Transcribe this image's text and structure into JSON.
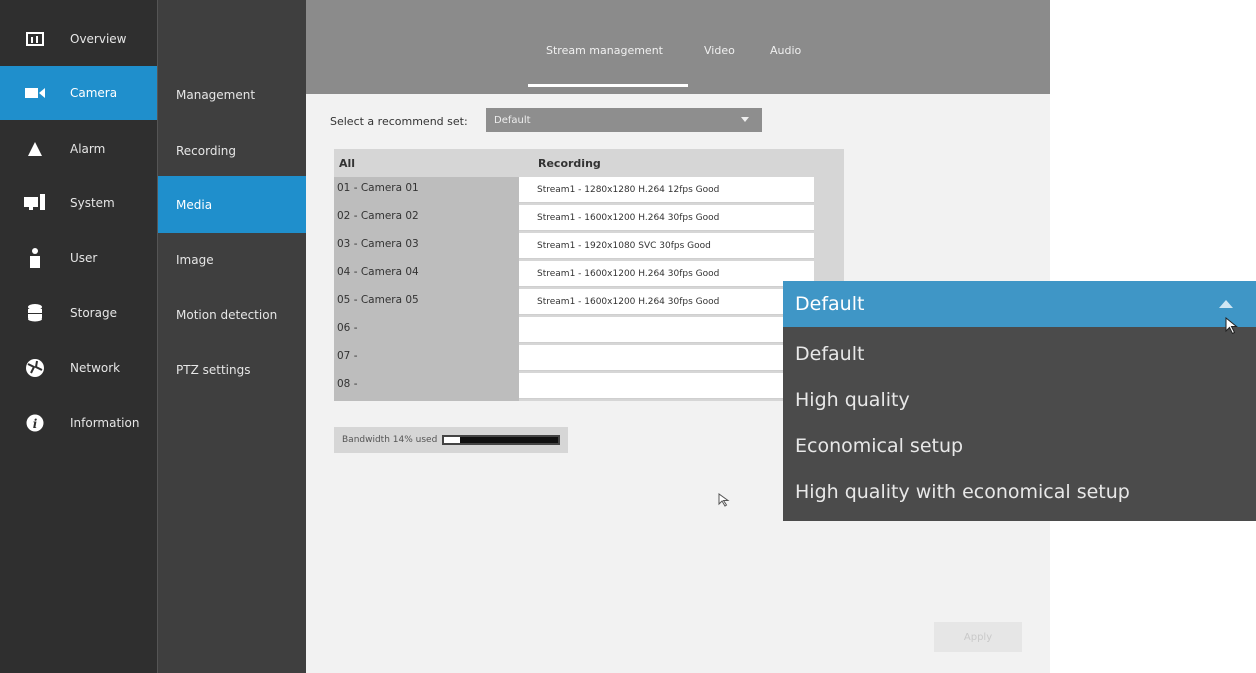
{
  "nav": {
    "items": [
      {
        "label": "Overview",
        "icon": "overview-icon"
      },
      {
        "label": "Camera",
        "icon": "camera-icon"
      },
      {
        "label": "Alarm",
        "icon": "alarm-icon"
      },
      {
        "label": "System",
        "icon": "system-icon"
      },
      {
        "label": "User",
        "icon": "user-icon"
      },
      {
        "label": "Storage",
        "icon": "storage-icon"
      },
      {
        "label": "Network",
        "icon": "network-icon"
      },
      {
        "label": "Information",
        "icon": "information-icon"
      }
    ],
    "active": "Camera"
  },
  "subnav": {
    "items": [
      {
        "label": "Management"
      },
      {
        "label": "Recording"
      },
      {
        "label": "Media"
      },
      {
        "label": "Image"
      },
      {
        "label": "Motion detection"
      },
      {
        "label": "PTZ settings"
      }
    ],
    "active": "Media"
  },
  "tabs": [
    {
      "label": "Stream management"
    },
    {
      "label": "Video"
    },
    {
      "label": "Audio"
    }
  ],
  "recommend": {
    "label": "Select a recommend set:",
    "value": "Default"
  },
  "table": {
    "headers": {
      "camera": "All",
      "recording": "Recording"
    },
    "rows": [
      {
        "camera": "01 - Camera 01",
        "recording": "Stream1 - 1280x1280 H.264 12fps Good"
      },
      {
        "camera": "02 - Camera 02",
        "recording": "Stream1 - 1600x1200 H.264 30fps Good"
      },
      {
        "camera": "03 - Camera 03",
        "recording": "Stream1 - 1920x1080 SVC 30fps Good"
      },
      {
        "camera": "04 - Camera 04",
        "recording": "Stream1 - 1600x1200 H.264 30fps Good"
      },
      {
        "camera": "05 - Camera 05",
        "recording": "Stream1 - 1600x1200 H.264 30fps Good"
      },
      {
        "camera": "06 -",
        "recording": ""
      },
      {
        "camera": "07 -",
        "recording": ""
      },
      {
        "camera": "08 -",
        "recording": ""
      }
    ]
  },
  "bandwidth": {
    "label": "Bandwidth 14% used",
    "percent": 14
  },
  "apply_label": "Apply",
  "dropdown": {
    "selected": "Default",
    "options": [
      "Default",
      "High quality",
      "Economical setup",
      "High quality with economical setup"
    ]
  },
  "colors": {
    "accent": "#1f8fcc",
    "dropdown_highlight": "#3f96c6",
    "nav_bg": "#2f2f2f"
  }
}
